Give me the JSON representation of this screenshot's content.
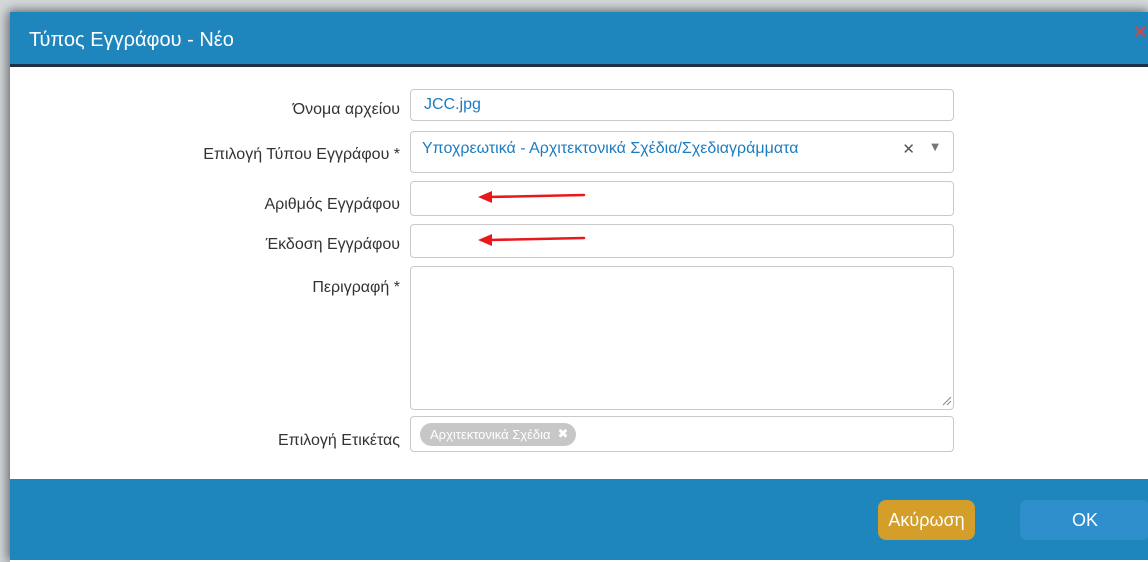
{
  "dialog": {
    "title": "Τύπος Εγγράφου - Νέο",
    "close_icon": "close-icon",
    "accent_color": "#1e86bd"
  },
  "form": {
    "file_name": {
      "label": "Όνομα αρχείου",
      "value": "JCC.jpg"
    },
    "document_type": {
      "label": "Επιλογή Τύπου Εγγράφου *",
      "value": "Υποχρεωτικά - Αρχιτεκτονικά Σχέδια/Σχεδιαγράμματα",
      "clear_icon": "clear-icon",
      "caret_icon": "chevron-down-icon"
    },
    "document_number": {
      "label": "Αριθμός Εγγράφου",
      "value": ""
    },
    "document_version": {
      "label": "Έκδοση Εγγράφου",
      "value": ""
    },
    "description": {
      "label": "Περιγραφή *",
      "value": ""
    },
    "tag_select": {
      "label": "Επιλογή Ετικέτας",
      "tags": [
        "Αρχιτεκτονικά Σχέδια"
      ],
      "tag_color": "#c7c7c7"
    }
  },
  "annotations": {
    "arrow_color": "#e8191c"
  },
  "footer": {
    "cancel_label": "Ακύρωση",
    "ok_label": "OK",
    "cancel_color": "#d39e2a",
    "ok_color": "#2f8fcc"
  }
}
